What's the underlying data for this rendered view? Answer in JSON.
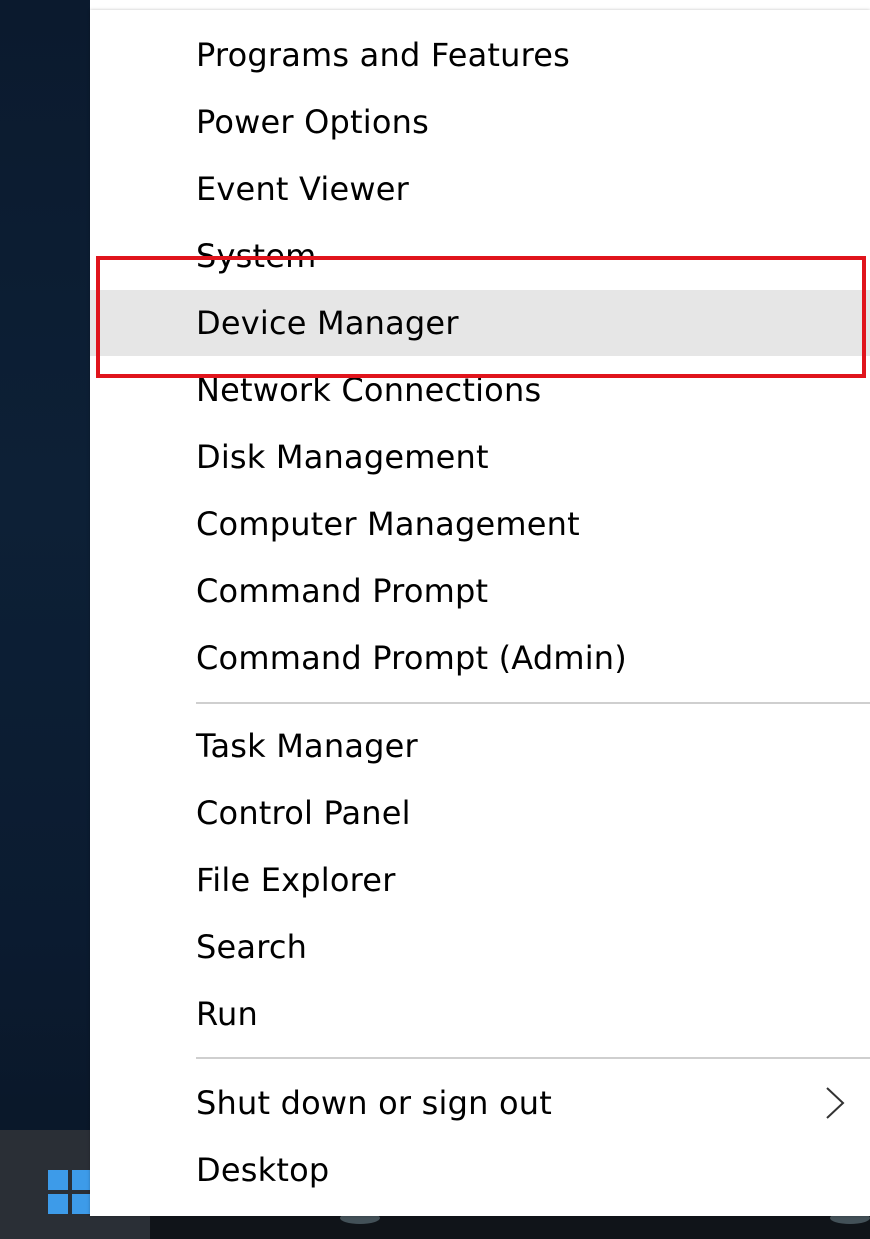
{
  "menu": {
    "items": [
      {
        "id": "programs-and-features",
        "label": "Programs and Features"
      },
      {
        "id": "power-options",
        "label": "Power Options"
      },
      {
        "id": "event-viewer",
        "label": "Event Viewer"
      },
      {
        "id": "system",
        "label": "System"
      },
      {
        "id": "device-manager",
        "label": "Device Manager"
      },
      {
        "id": "network-connections",
        "label": "Network Connections"
      },
      {
        "id": "disk-management",
        "label": "Disk Management"
      },
      {
        "id": "computer-management",
        "label": "Computer Management"
      },
      {
        "id": "command-prompt",
        "label": "Command Prompt"
      },
      {
        "id": "command-prompt-admin",
        "label": "Command Prompt (Admin)"
      },
      {
        "id": "task-manager",
        "label": "Task Manager"
      },
      {
        "id": "control-panel",
        "label": "Control Panel"
      },
      {
        "id": "file-explorer",
        "label": "File Explorer"
      },
      {
        "id": "search",
        "label": "Search"
      },
      {
        "id": "run",
        "label": "Run"
      },
      {
        "id": "shut-down-or-sign-out",
        "label": "Shut down or sign out",
        "submenu": true
      },
      {
        "id": "desktop",
        "label": "Desktop"
      }
    ],
    "highlighted": "Device Manager",
    "submenu_icon": "chevron-right-icon"
  },
  "taskbar": {
    "start_icon": "windows-logo-icon"
  },
  "colors": {
    "highlight_border": "#e0141c",
    "hover_background": "#e6e6e6",
    "start_logo": "#3d9be9"
  }
}
